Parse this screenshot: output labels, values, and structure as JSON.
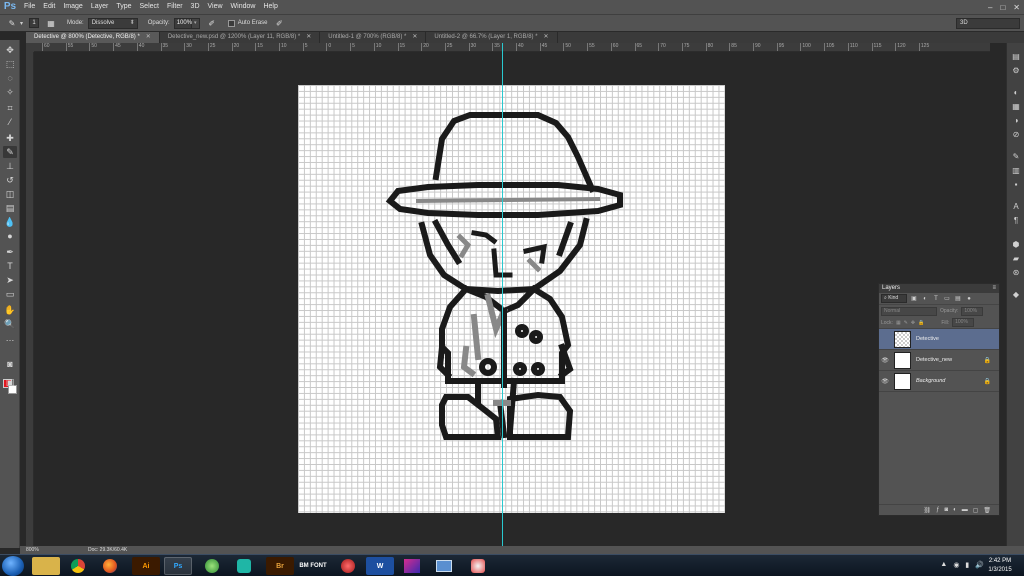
{
  "app": {
    "logo": "Ps"
  },
  "menu": [
    "File",
    "Edit",
    "Image",
    "Layer",
    "Type",
    "Select",
    "Filter",
    "3D",
    "View",
    "Window",
    "Help"
  ],
  "window_controls": {
    "min": "–",
    "max": "□",
    "close": "✕"
  },
  "options": {
    "brush_size": "1",
    "mode_label": "Mode:",
    "mode_value": "Dissolve",
    "opacity_label": "Opacity:",
    "opacity_value": "100%",
    "auto_erase_label": "Auto Erase",
    "workspace": "3D"
  },
  "tabs": [
    {
      "label": "Detective @ 800% (Detective, RGB/8) *",
      "active": true
    },
    {
      "label": "Detective_new.psd @ 1200% (Layer 11, RGB/8) *",
      "active": false
    },
    {
      "label": "Untitled-1 @ 700% (RGB/8) *",
      "active": false
    },
    {
      "label": "Untitled-2 @ 66.7% (Layer 1, RGB/8) *",
      "active": false
    }
  ],
  "ruler": {
    "ticks": [
      "60",
      "55",
      "50",
      "45",
      "40",
      "35",
      "30",
      "25",
      "20",
      "15",
      "10",
      "5",
      "0",
      "5",
      "10",
      "15",
      "20",
      "25",
      "30",
      "35",
      "40",
      "45",
      "50",
      "55",
      "60",
      "65",
      "70",
      "75",
      "80",
      "85",
      "90",
      "95",
      "100",
      "105",
      "110",
      "115",
      "120",
      "125"
    ]
  },
  "layers_panel": {
    "title": "Layers",
    "kind_label": "Kind",
    "blend_mode": "Normal",
    "opacity_label": "Opacity:",
    "opacity_value": "100%",
    "lock_label": "Lock:",
    "fill_label": "Fill:",
    "fill_value": "100%",
    "layers": [
      {
        "name": "Detective",
        "visible": false,
        "active": true,
        "locked": false
      },
      {
        "name": "Detective_new",
        "visible": true,
        "active": false,
        "locked": true
      },
      {
        "name": "Background",
        "visible": true,
        "active": false,
        "locked": true
      }
    ]
  },
  "status": {
    "zoom": "800%",
    "doc": "Doc: 29.3K/60.4K"
  },
  "taskbar": {
    "apps": [
      "",
      "",
      "",
      "Ai",
      "Ps",
      "",
      "",
      "Br",
      "BM FONT",
      "",
      "W",
      "",
      "",
      ""
    ],
    "clock_time": "2:42 PM",
    "clock_date": "1/3/2015"
  },
  "colors": {
    "foreground": "#e3161e",
    "background": "#ffffff",
    "guide": "#29c9cf",
    "selected_layer": "#5c6d8f"
  }
}
